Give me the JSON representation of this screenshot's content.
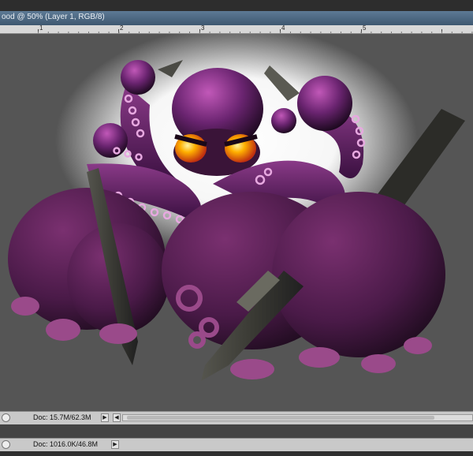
{
  "window": {
    "tab_title": "ood @ 50% (Layer 1, RGB/8)"
  },
  "ruler": {
    "numbers": [
      "1",
      "2",
      "3",
      "4",
      "5"
    ]
  },
  "status_bar": {
    "doc_info": "Doc: 15.7M/62.3M",
    "arrow": "▶",
    "left_arrow": "◀"
  },
  "status_bar_2": {
    "doc_info": "Doc: 1016.0K/46.8M",
    "arrow": "▶"
  },
  "canvas": {
    "artwork": "purple-octopus-with-pens",
    "colors": {
      "background": "#555555",
      "octopus_purple": "#6a2a6e",
      "eyes": "#ffb000",
      "glow": "#ffffff",
      "pen": "#3a3a36"
    }
  }
}
